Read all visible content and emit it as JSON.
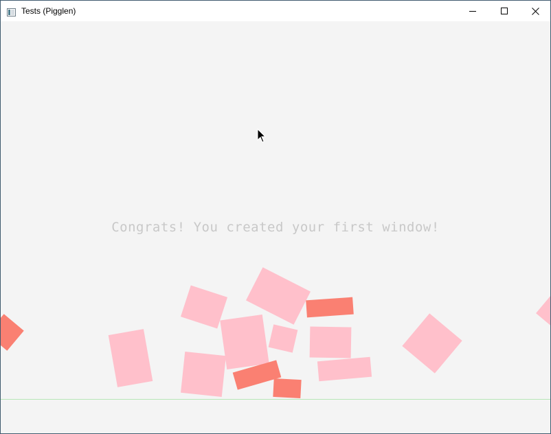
{
  "window": {
    "title": "Tests (Pigglen)",
    "app_icon": "app-window-icon",
    "controls": {
      "minimize_icon": "minimize-icon",
      "maximize_icon": "maximize-icon",
      "close_icon": "close-icon"
    }
  },
  "scene": {
    "background_color": "#f4f4f4",
    "message": "Congrats! You created your first window!",
    "message_color": "#c8c8c8",
    "ground_color": "#b7e6b7",
    "block_colors": {
      "pink": "#ffc0cb",
      "salmon": "#fa8072"
    },
    "cursor_icon": "mouse-pointer-icon"
  }
}
